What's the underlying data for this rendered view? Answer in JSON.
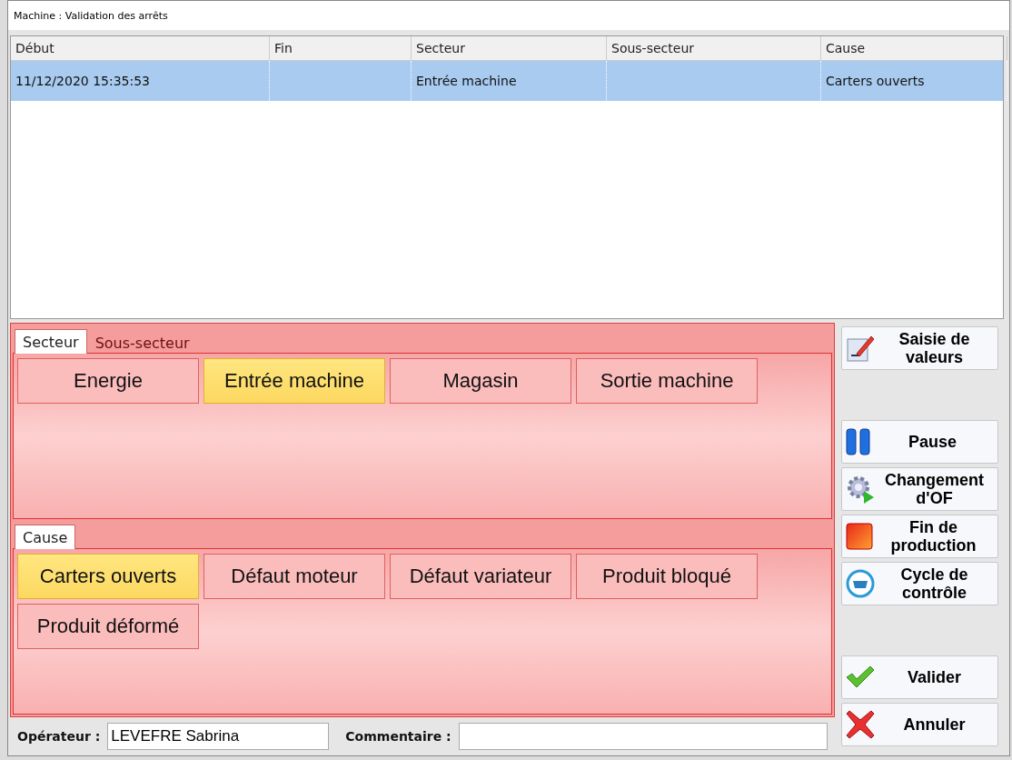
{
  "window": {
    "title": "Machine : Validation des arrêts"
  },
  "table": {
    "columns": [
      "Début",
      "Fin",
      "Secteur",
      "Sous-secteur",
      "Cause"
    ],
    "rows": [
      {
        "cells": [
          "11/12/2020 15:35:53",
          "",
          "Entrée machine",
          "",
          "Carters ouverts"
        ],
        "selected": true
      }
    ]
  },
  "panels": [
    {
      "tabs": [
        {
          "label": "Secteur",
          "selected": true
        },
        {
          "label": "Sous-secteur",
          "selected": false
        }
      ],
      "options": [
        {
          "label": "Energie",
          "selected": false
        },
        {
          "label": "Entrée machine",
          "selected": true
        },
        {
          "label": "Magasin",
          "selected": false
        },
        {
          "label": "Sortie machine",
          "selected": false
        }
      ]
    },
    {
      "tabs": [
        {
          "label": "Cause",
          "selected": true
        }
      ],
      "options": [
        {
          "label": "Carters ouverts",
          "selected": true
        },
        {
          "label": "Défaut moteur",
          "selected": false
        },
        {
          "label": "Défaut variateur",
          "selected": false
        },
        {
          "label": "Produit bloqué",
          "selected": false
        },
        {
          "label": "Produit déformé",
          "selected": false
        }
      ]
    }
  ],
  "action_groups": [
    {
      "buttons": [
        {
          "label": "Saisie de valeurs",
          "kind": "edit"
        }
      ]
    },
    {
      "buttons": [
        {
          "label": "Pause",
          "kind": "pause"
        },
        {
          "label": "Changement d'OF",
          "kind": "gear"
        },
        {
          "label": "Fin de production",
          "kind": "stop"
        },
        {
          "label": "Cycle de contrôle",
          "kind": "cycle"
        }
      ]
    },
    {
      "buttons": [
        {
          "label": "Valider",
          "kind": "check"
        },
        {
          "label": "Annuler",
          "kind": "cross"
        }
      ]
    }
  ],
  "footer": {
    "operator": {
      "label": "Opérateur :",
      "value": "LEVEFRE Sabrina"
    },
    "comment": {
      "label": "Commentaire :"
    }
  }
}
